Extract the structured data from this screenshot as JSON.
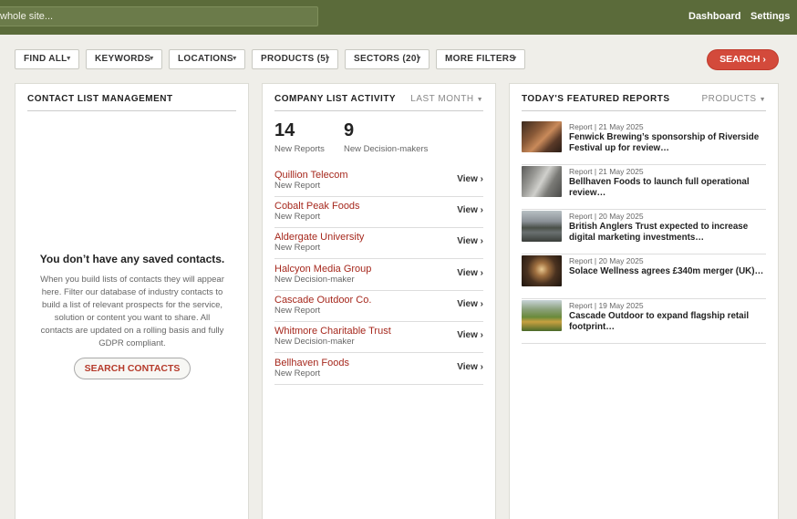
{
  "topbar": {
    "search_text": "whole site...",
    "nav": [
      "Dashboard",
      "Settings"
    ]
  },
  "filters": {
    "buttons": [
      "FIND ALL",
      "KEYWORDS",
      "LOCATIONS",
      "PRODUCTS (5)",
      "SECTORS (20)",
      "MORE FILTERS"
    ],
    "search_label": "SEARCH ›"
  },
  "contacts_panel": {
    "title": "CONTACT LIST MANAGEMENT",
    "empty_title": "You don’t have any saved contacts.",
    "empty_text": "When you build lists of contacts they will appear here. Filter our database of industry contacts to build a list of relevant prospects for the service, solution or content you want to share. All contacts are updated on a rolling basis and fully GDPR compliant.",
    "button": "SEARCH CONTACTS"
  },
  "activity_panel": {
    "title": "COMPANY LIST ACTIVITY",
    "period": "LAST MONTH",
    "stats": [
      {
        "value": "14",
        "label": "New Reports"
      },
      {
        "value": "9",
        "label": "New Decision-makers"
      }
    ],
    "view_label": "View ›",
    "rows": [
      {
        "name": "Quillion Telecom",
        "type": "New Report"
      },
      {
        "name": "Cobalt Peak Foods",
        "type": "New Report"
      },
      {
        "name": "Aldergate University",
        "type": "New Report"
      },
      {
        "name": "Halcyon Media Group",
        "type": "New Decision-maker"
      },
      {
        "name": "Cascade Outdoor Co.",
        "type": "New Report"
      },
      {
        "name": "Whitmore Charitable Trust",
        "type": "New Decision-maker"
      },
      {
        "name": "Bellhaven Foods",
        "type": "New Report"
      }
    ]
  },
  "reports_panel": {
    "title": "TODAY'S FEATURED REPORTS",
    "filter": "PRODUCTS",
    "items": [
      {
        "meta": "Report  |  21 May 2025",
        "title": "Fenwick Brewing’s sponsorship of Riverside Festival up for review…",
        "thumb": "brewery-crowd"
      },
      {
        "meta": "Report  |  21 May 2025",
        "title": "Bellhaven Foods to launch full operational review…",
        "thumb": "factory-interior"
      },
      {
        "meta": "Report  |  20 May 2025",
        "title": "British Anglers Trust expected to increase digital marketing investments…",
        "thumb": "lake-landscape"
      },
      {
        "meta": "Report  |  20 May 2025",
        "title": "Solace Wellness agrees £340m merger (UK)…",
        "thumb": "spa-room"
      },
      {
        "meta": "Report  |  19 May 2025",
        "title": "Cascade Outdoor to expand flagship retail footprint…",
        "thumb": "hiker-mountains"
      }
    ]
  }
}
